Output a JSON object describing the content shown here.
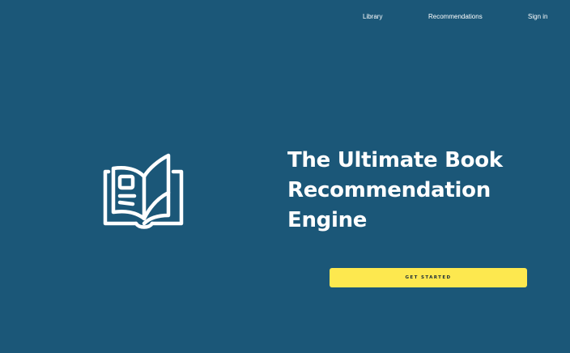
{
  "nav": {
    "library": "Library",
    "recommendations": "Recommendations",
    "sign_in": "Sign in"
  },
  "hero": {
    "title_lines": [
      "The Ultimate Book",
      "Recommendation",
      "Engine"
    ],
    "icon": "open-book-icon",
    "cta_label": "GET STARTED"
  },
  "colors": {
    "background": "#1b5778",
    "accent": "#fde84f",
    "text": "#ffffff"
  }
}
